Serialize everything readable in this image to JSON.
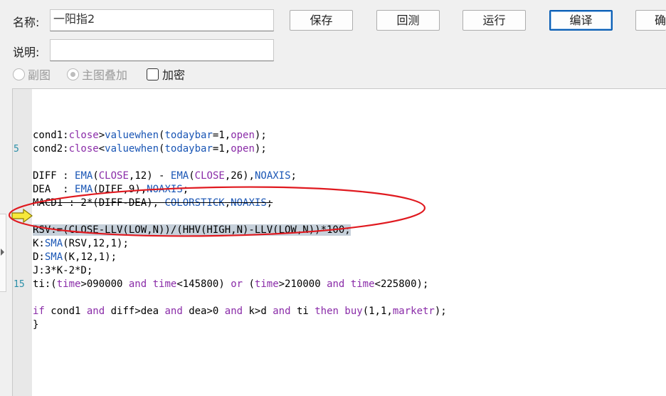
{
  "form": {
    "name_label": "名称:",
    "name_value": "一阳指2",
    "desc_label": "说明:",
    "desc_value": ""
  },
  "toolbar": {
    "save": "保存",
    "backtest": "回测",
    "run": "运行",
    "compile": "编译",
    "confirm": "确"
  },
  "options": {
    "sub_chart": "副图",
    "main_overlay": "主图叠加",
    "encrypt": "加密"
  },
  "editor": {
    "line_numbers": [
      {
        "n": "5"
      },
      {
        "n": "15"
      }
    ],
    "lines": [
      "",
      "cond1:close>valuewhen(todaybar=1,open);",
      "cond2:close<valuewhen(todaybar=1,open);",
      "",
      "DIFF : EMA(CLOSE,12) - EMA(CLOSE,26),NOAXIS;",
      "DEA  : EMA(DIFF,9),NOAXIS;",
      "MACD1 : 2*(DIFF-DEA), COLORSTICK,NOAXIS;",
      "",
      "RSV:=(CLOSE-LLV(LOW,N))/(HHV(HIGH,N)-LLV(LOW,N))*100;",
      "K:SMA(RSV,12,1);",
      "D:SMA(K,12,1);",
      "J:3*K-2*D;",
      "ti:(time>090000 and time<145800) or (time>210000 and time<225800);",
      "",
      "if cond1 and diff>dea and dea>0 and k>d and ti then buy(1,1,marketr);",
      "}"
    ],
    "highlighted_line": 8
  },
  "colors": {
    "function": "#1a56b5",
    "keyword": "#8a2ca8",
    "annotation": "#e0191f",
    "highlight": "#c6d0da"
  }
}
